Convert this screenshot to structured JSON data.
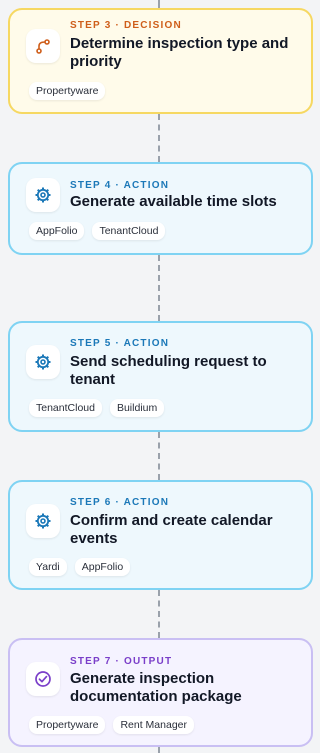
{
  "steps": [
    {
      "kind": "decision",
      "label": "STEP 3 · DECISION",
      "title": "Determine inspection type and priority",
      "icon": "branch-icon",
      "chips": [
        "Propertyware"
      ]
    },
    {
      "kind": "action",
      "label": "STEP 4 · ACTION",
      "title": "Generate available time slots",
      "icon": "gear-icon",
      "chips": [
        "AppFolio",
        "TenantCloud"
      ]
    },
    {
      "kind": "action",
      "label": "STEP 5 · ACTION",
      "title": "Send scheduling request to tenant",
      "icon": "gear-icon",
      "chips": [
        "TenantCloud",
        "Buildium"
      ]
    },
    {
      "kind": "action",
      "label": "STEP 6 · ACTION",
      "title": "Confirm and create calendar events",
      "icon": "gear-icon",
      "chips": [
        "Yardi",
        "AppFolio"
      ]
    },
    {
      "kind": "output",
      "label": "STEP 7 · OUTPUT",
      "title": "Generate inspection documentation package",
      "icon": "check-circle-icon",
      "chips": [
        "Propertyware",
        "Rent Manager"
      ]
    }
  ],
  "colors": {
    "decision_accent": "#cf5e1a",
    "action_accent": "#1b78b8",
    "output_accent": "#7a3ec9"
  }
}
